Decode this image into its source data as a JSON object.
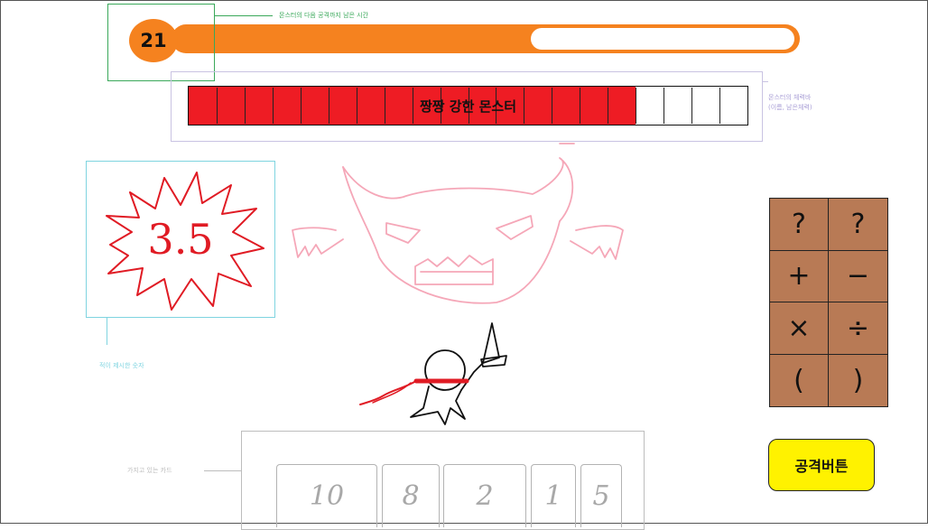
{
  "timer": {
    "value": "21",
    "note": "몬스터의 다음 공격까지 남은 시간",
    "remaining_fraction": 0.57,
    "bar_color": "#f5821f"
  },
  "monster": {
    "name": "짱짱 강한 몬스터",
    "hp_fraction": 0.8,
    "hp_segments": 20,
    "hp_color": "#ee1c24",
    "note_line1": "몬스터의 체력바",
    "note_line2": "(이름, 남은체력)"
  },
  "target": {
    "number": "3.5",
    "note": "적이 제시한 숫자",
    "color": "#e01b24"
  },
  "operators": {
    "keys": [
      "?",
      "?",
      "+",
      "−",
      "×",
      "÷",
      "(",
      ")"
    ],
    "bg_color": "#b87a55"
  },
  "attack_button": {
    "label": "공격버튼",
    "color": "#fff200"
  },
  "hand": {
    "note": "가지고 있는 카드",
    "cards": [
      "10",
      "8",
      "2",
      "1",
      "5"
    ]
  }
}
